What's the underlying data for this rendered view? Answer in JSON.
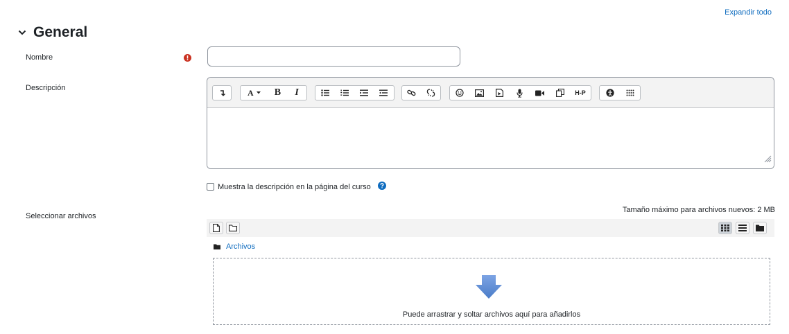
{
  "header": {
    "expand_all": "Expandir todo",
    "section_title": "General"
  },
  "form": {
    "name_label": "Nombre",
    "name_value": "",
    "description_label": "Descripción",
    "show_description_label": "Muestra la descripción en la página del curso",
    "show_description_checked": false,
    "select_files_label": "Seleccionar archivos"
  },
  "editor": {
    "toolbar_groups": [
      [
        "collapse-icon"
      ],
      [
        "font-style-icon",
        "bold-icon",
        "italic-icon"
      ],
      [
        "bulleted-list-icon",
        "numbered-list-icon",
        "indent-icon",
        "outdent-icon"
      ],
      [
        "link-icon",
        "unlink-icon"
      ],
      [
        "emoji-icon",
        "image-icon",
        "media-icon",
        "record-audio-icon",
        "record-video-icon",
        "manage-files-icon",
        "h5p-icon"
      ],
      [
        "accessibility-checker-icon",
        "screenreader-helper-icon"
      ]
    ],
    "labels": {
      "font_style": "A",
      "bold": "B",
      "italic": "I",
      "h5p": "H-P"
    },
    "content": ""
  },
  "filepicker": {
    "max_size_text": "Tamaño máximo para archivos nuevos: 2 MB",
    "folder_label": "Archivos",
    "drop_text": "Puede arrastrar y soltar archivos aquí para añadirlos",
    "view_modes": [
      "icons-view-icon",
      "list-view-icon",
      "tree-view-icon"
    ],
    "active_view": "icons-view-icon"
  },
  "colors": {
    "link": "#0f6cbf",
    "required": "#ca3120",
    "help": "#0f6cbf",
    "drop_arrow": "#5b8dd6",
    "toolbar_bg": "#f3f3f3"
  }
}
